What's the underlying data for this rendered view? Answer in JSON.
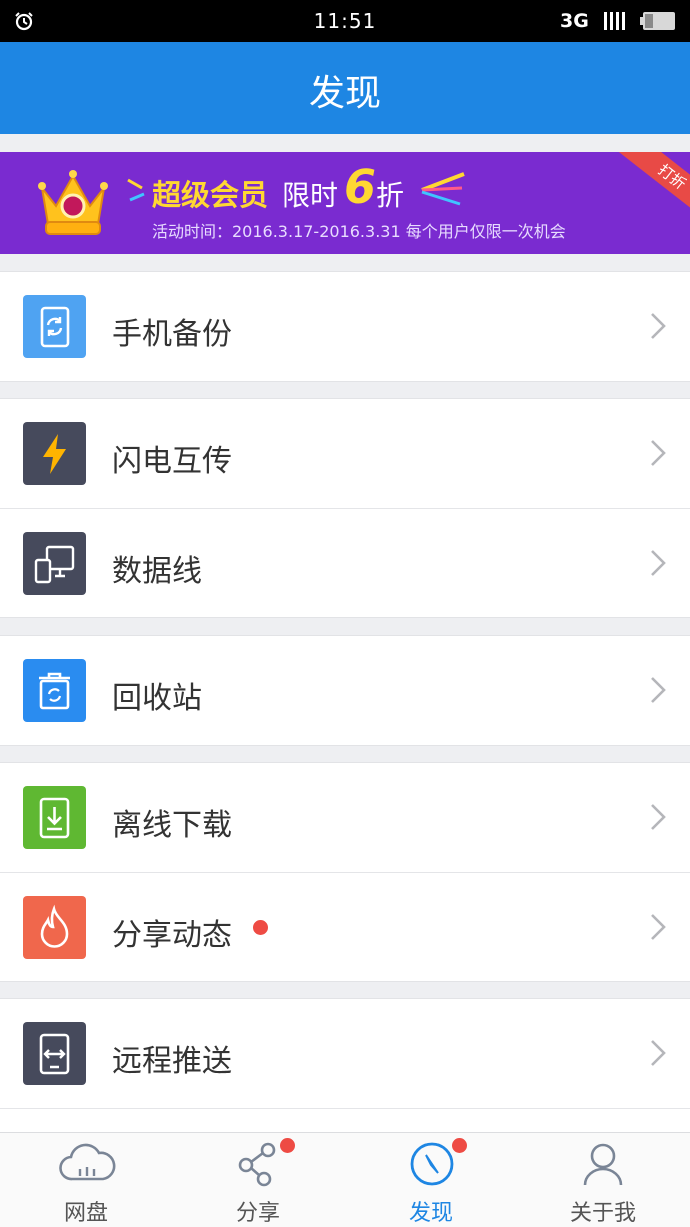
{
  "status_bar": {
    "time": "11:51",
    "network": "3G"
  },
  "header": {
    "title": "发现"
  },
  "banner": {
    "headline": "超级会员",
    "limit_text": "限时",
    "discount_number": "6",
    "discount_unit": "折",
    "subtitle": "活动时间：2016.3.17-2016.3.31   每个用户仅限一次机会",
    "ribbon": "打折"
  },
  "menu": {
    "backup": {
      "label": "手机备份",
      "color": "#4fa3f2"
    },
    "flash": {
      "label": "闪电互传",
      "color": "#464a5c"
    },
    "cable": {
      "label": "数据线",
      "color": "#464a5c"
    },
    "recycle": {
      "label": "回收站",
      "color": "#2a8cf0"
    },
    "offline": {
      "label": "离线下载",
      "color": "#5fb832"
    },
    "share_feed": {
      "label": "分享动态",
      "color": "#f0674c"
    },
    "remote_push": {
      "label": "远程推送",
      "color": "#464a5c"
    }
  },
  "tabs": {
    "cloud": {
      "label": "网盘"
    },
    "share": {
      "label": "分享"
    },
    "discover": {
      "label": "发现"
    },
    "me": {
      "label": "关于我"
    }
  },
  "colors": {
    "brand_blue": "#1e86e3",
    "banner_purple": "#7a2bd0",
    "badge_red": "#ee4b44"
  }
}
